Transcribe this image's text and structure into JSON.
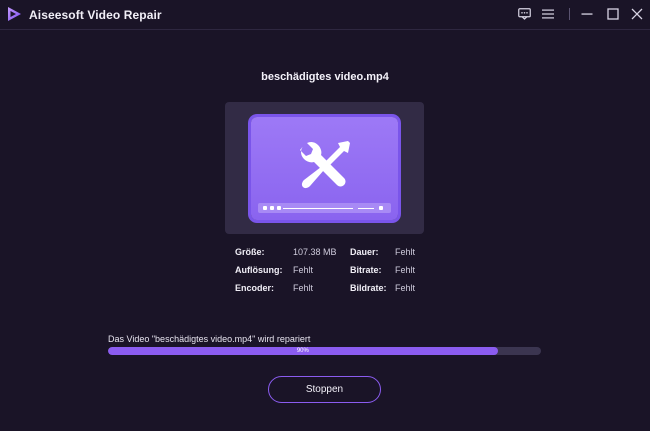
{
  "window": {
    "app_title": "Aiseesoft Video Repair",
    "accent_color": "#8b5cf0",
    "icons": [
      "feedback-icon",
      "menu-icon",
      "minimize-icon",
      "maximize-icon",
      "close-icon"
    ]
  },
  "file": {
    "name": "beschädigtes video.mp4"
  },
  "info": {
    "size_label": "Größe:",
    "size_value": "107.38 MB",
    "duration_label": "Dauer:",
    "duration_value": "Fehlt",
    "resolution_label": "Auflösung:",
    "resolution_value": "Fehlt",
    "bitrate_label": "Bitrate:",
    "bitrate_value": "Fehlt",
    "encoder_label": "Encoder:",
    "encoder_value": "Fehlt",
    "framerate_label": "Bildrate:",
    "framerate_value": "Fehlt"
  },
  "progress": {
    "status": "Das Video \"beschädigtes video.mp4\" wird repariert",
    "percent": 90,
    "percent_label": "90%"
  },
  "actions": {
    "stop_label": "Stoppen"
  }
}
